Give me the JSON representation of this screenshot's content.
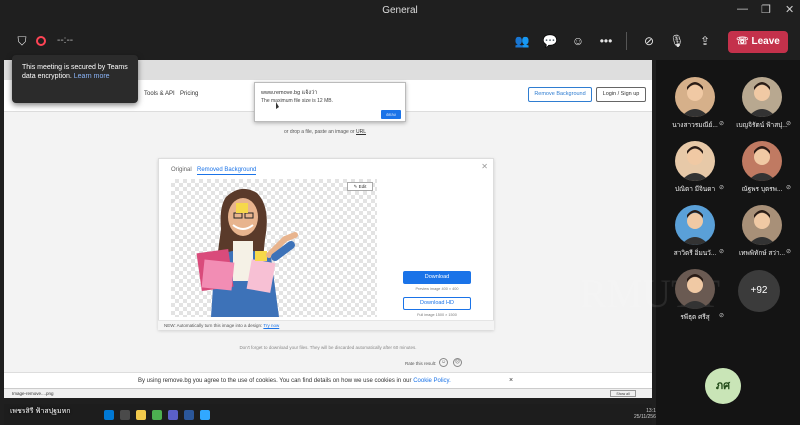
{
  "window": {
    "title": "General"
  },
  "toolbar": {
    "timer": "--:--",
    "leave_label": "Leave"
  },
  "tooltip": {
    "text": "This meeting is secured by Teams data encryption.",
    "link": "Learn more"
  },
  "site": {
    "nav": [
      "Tools & API",
      "Pricing"
    ],
    "remove_bg_label": "Remove Background",
    "login_label": "Login / Sign up",
    "popup_url": "www.remove.bg แจ้งว่า",
    "popup_msg": "The maximum file size is 12 MB.",
    "popup_ok": "ตกลง",
    "drop_text": "or drop a file, paste an image or",
    "drop_link": "URL",
    "tab_original": "Original",
    "tab_removed": "Removed Background",
    "edit_label": "✎ Edit",
    "download_label": "Download",
    "download_note": "Preview image 400 × 400",
    "download_hd_label": "Download HD",
    "download_hd_note": "Full image 1500 × 1500",
    "rate_text": "Rate this result:",
    "card_footer": "NEW: Automatically turn this image into a design:",
    "card_footer_link": "Try now",
    "dont_forget": "Don't forget to download your files. They will be discarded automatically after 60 minutes.",
    "cookie_text": "By using remove.bg you agree to the use of cookies. You can find details on how we use cookies in our",
    "cookie_link": "Cookie Policy.",
    "cookie_close": "×",
    "download_file": "Image-remove....png",
    "show_all": "Show all"
  },
  "presenter": "เพชรสิรี ฟ้าสปุฐมหก",
  "clock": {
    "time": "13:12",
    "date": "25/11/2565"
  },
  "participants": [
    {
      "name": "นางสาวรมณีย์...",
      "bg": "#d6b08a"
    },
    {
      "name": "เบญจิรัตน์ ฟ้าสปุ...",
      "bg": "#b8a890"
    },
    {
      "name": "ปณิตา มีจินดา",
      "bg": "#e7c9a8"
    },
    {
      "name": "ณัฐพร บุตรพ...",
      "bg": "#c07a62"
    },
    {
      "name": "สาวิตรี อิ่มนวั...",
      "bg": "#5aa0d8"
    },
    {
      "name": "เทพพิทักษ์ สว่า...",
      "bg": "#a89078"
    },
    {
      "name": "รพีธุต ศรีสุ",
      "bg": "#6a5a52"
    }
  ],
  "more_count": "+92",
  "self_initials": "ภศ",
  "watermark": "RMUTT"
}
